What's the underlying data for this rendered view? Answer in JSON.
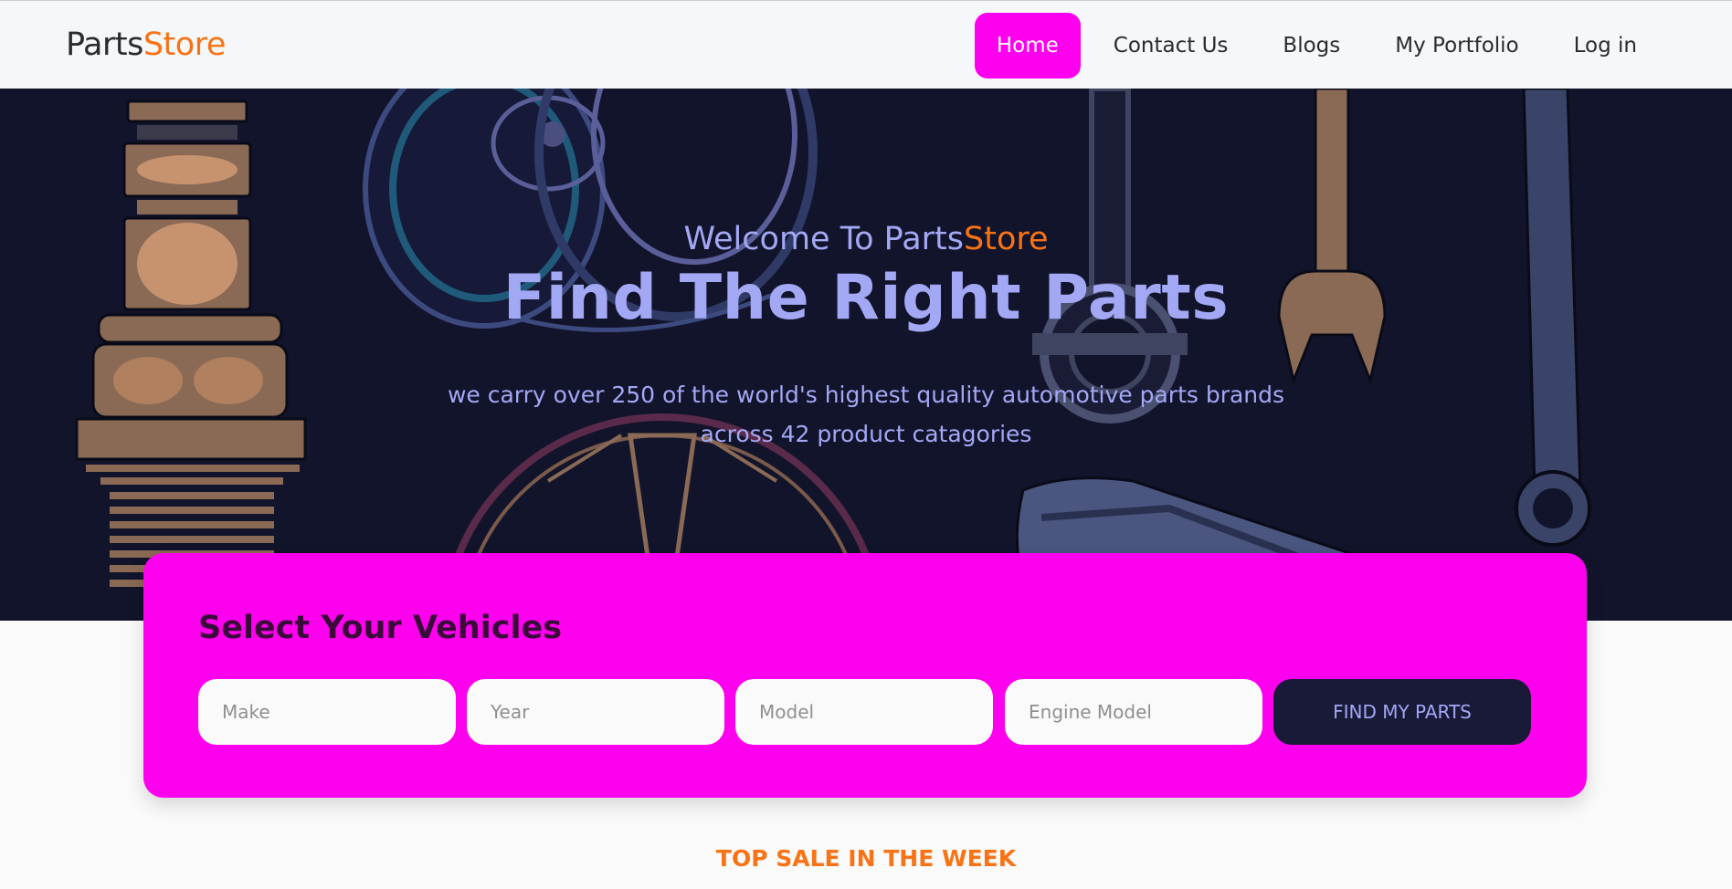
{
  "brand": {
    "part1": "Parts",
    "part2": "Store"
  },
  "nav": [
    {
      "label": "Home",
      "active": true
    },
    {
      "label": "Contact Us",
      "active": false
    },
    {
      "label": "Blogs",
      "active": false
    },
    {
      "label": "My Portfolio",
      "active": false
    },
    {
      "label": "Log in",
      "active": false
    }
  ],
  "hero": {
    "welcome_prefix": "Welcome To ",
    "welcome_brand1": "Parts",
    "welcome_brand2": "Store",
    "title": "Find The Right Parts",
    "description": "we carry over 250 of the world's highest quality automotive parts brands across 42 product catagories"
  },
  "vehicle_form": {
    "title": "Select Your Vehicles",
    "make_placeholder": "Make",
    "year_placeholder": "Year",
    "model_placeholder": "Model",
    "engine_placeholder": "Engine Model",
    "button_label": "FIND MY PARTS"
  },
  "section": {
    "title": "TOP SALE IN THE WEEK"
  },
  "colors": {
    "accent_magenta": "#ff00ee",
    "accent_orange": "#f97316",
    "hero_bg": "#12142b",
    "hero_text": "#a3a8f5",
    "button_bg": "#181a38"
  },
  "icons": [
    "spark-plug-icon",
    "turbocharger-icon",
    "connecting-rod-icon",
    "wrench-icon",
    "socket-wrench-icon",
    "wheel-rim-icon",
    "exhaust-muffler-icon"
  ]
}
